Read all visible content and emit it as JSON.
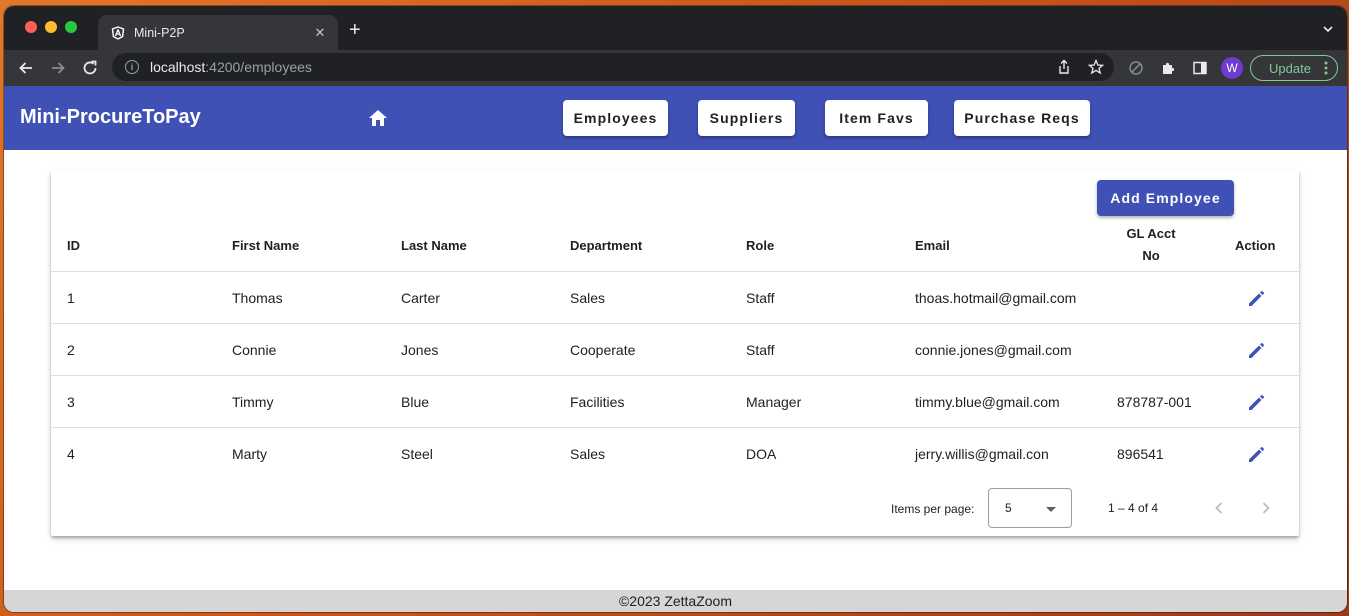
{
  "browser": {
    "tab_title": "Mini-P2P",
    "url_host": "localhost",
    "url_path": ":4200/employees",
    "profile_initial": "W",
    "update_label": "Update"
  },
  "app": {
    "brand": "Mini-ProcureToPay",
    "nav": [
      "Employees",
      "Suppliers",
      "Item Favs",
      "Purchase Reqs"
    ],
    "accent_color": "#3f51b5"
  },
  "table": {
    "add_button_label": "Add Employee",
    "columns": [
      "ID",
      "First Name",
      "Last Name",
      "Department",
      "Role",
      "Email",
      "GL Acct",
      "No",
      "Action"
    ],
    "rows": [
      {
        "id": "1",
        "first": "Thomas",
        "last": "Carter",
        "dept": "Sales",
        "role": "Staff",
        "email": "thoas.hotmail@gmail.com",
        "gl": ""
      },
      {
        "id": "2",
        "first": "Connie",
        "last": "Jones",
        "dept": "Cooperate",
        "role": "Staff",
        "email": "connie.jones@gmail.com",
        "gl": ""
      },
      {
        "id": "3",
        "first": "Timmy",
        "last": "Blue",
        "dept": "Facilities",
        "role": "Manager",
        "email": "timmy.blue@gmail.com",
        "gl": "878787-001"
      },
      {
        "id": "4",
        "first": "Marty",
        "last": "Steel",
        "dept": "Sales",
        "role": "DOA",
        "email": "jerry.willis@gmail.con",
        "gl": "896541"
      }
    ],
    "action_icon": "edit-icon"
  },
  "paginator": {
    "items_per_page_label": "Items per page:",
    "items_per_page_value": "5",
    "range_label": "1 – 4 of 4"
  },
  "footer": {
    "text": "©2023 ZettaZoom"
  }
}
